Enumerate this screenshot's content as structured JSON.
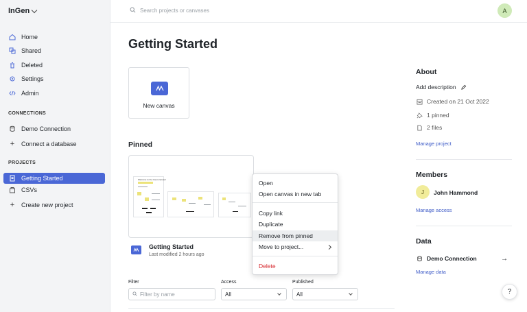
{
  "brand": {
    "name": "InGen"
  },
  "search": {
    "placeholder": "Search projects or canvases"
  },
  "user": {
    "avatar_letter": "A"
  },
  "sidebar": {
    "nav": [
      {
        "label": "Home",
        "icon": "home-icon"
      },
      {
        "label": "Shared",
        "icon": "shared-icon"
      },
      {
        "label": "Deleted",
        "icon": "trash-icon"
      },
      {
        "label": "Settings",
        "icon": "gear-icon"
      },
      {
        "label": "Admin",
        "icon": "code-icon"
      }
    ],
    "connections_label": "CONNECTIONS",
    "connections": [
      {
        "label": "Demo Connection",
        "icon": "database-icon"
      },
      {
        "label": "Connect a database",
        "icon": "plus-icon"
      }
    ],
    "projects_label": "PROJECTS",
    "projects": [
      {
        "label": "Getting Started",
        "icon": "project-icon",
        "active": true
      },
      {
        "label": "CSVs",
        "icon": "project-icon",
        "active": false
      },
      {
        "label": "Create new project",
        "icon": "plus-icon",
        "active": false
      }
    ]
  },
  "main": {
    "title": "Getting Started",
    "new_canvas_label": "New canvas",
    "pinned_heading": "Pinned",
    "pinned_card": {
      "title": "Getting Started",
      "subtitle": "Last modified 2 hours ago",
      "thumb_title": "Welcome to the Count canvas!"
    },
    "context_menu": {
      "items": [
        {
          "label": "Open"
        },
        {
          "label": "Open canvas in new tab"
        },
        {
          "label": "Copy link"
        },
        {
          "label": "Duplicate"
        },
        {
          "label": "Remove from pinned",
          "highlighted": true
        },
        {
          "label": "Move to project...",
          "submenu": true
        },
        {
          "label": "Delete",
          "danger": true
        }
      ]
    },
    "filters": {
      "filter_label": "Filter",
      "filter_placeholder": "Filter by name",
      "access_label": "Access",
      "access_value": "All",
      "published_label": "Published",
      "published_value": "All"
    }
  },
  "right": {
    "about_heading": "About",
    "add_description": "Add description",
    "created": "Created on 21 Oct 2022",
    "pinned_count": "1 pinned",
    "files_count": "2 files",
    "manage_project": "Manage project",
    "members_heading": "Members",
    "member": {
      "initial": "J",
      "name": "John Hammond"
    },
    "manage_access": "Manage access",
    "data_heading": "Data",
    "data_connection": "Demo Connection",
    "manage_data": "Manage data"
  },
  "help": {
    "label": "?"
  },
  "colors": {
    "accent": "#4a67d6",
    "danger": "#d6252b",
    "link": "#3e5bc7"
  }
}
